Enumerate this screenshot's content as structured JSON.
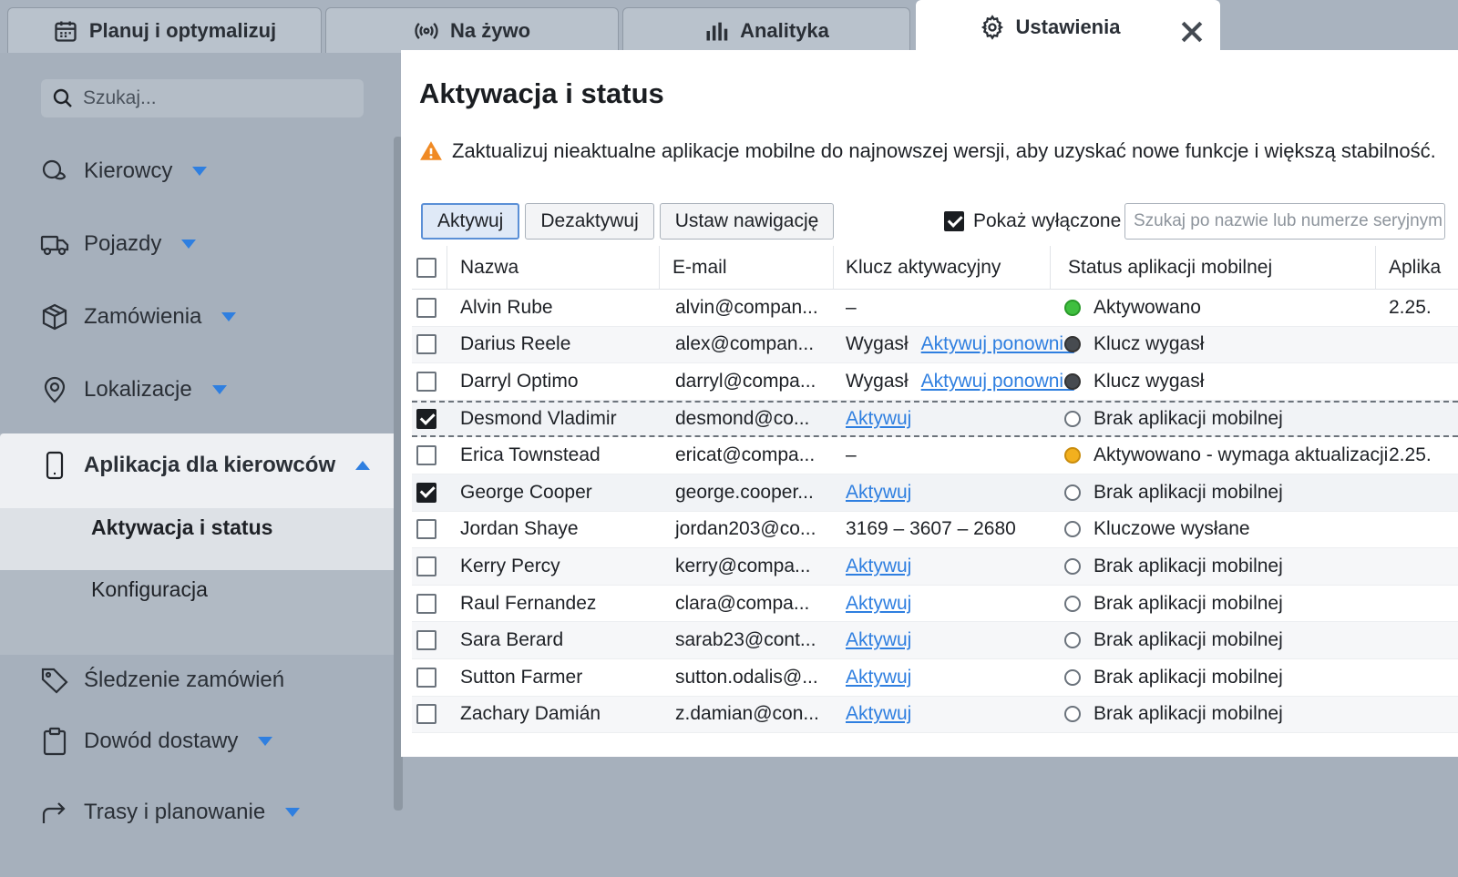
{
  "tabs": [
    {
      "label": "Planuj i optymalizuj",
      "icon": "calendar-icon"
    },
    {
      "label": "Na żywo",
      "icon": "broadcast-icon"
    },
    {
      "label": "Analityka",
      "icon": "bar-chart-icon"
    },
    {
      "label": "Ustawienia",
      "icon": "gear-icon",
      "active": true
    }
  ],
  "sidebar": {
    "search_placeholder": "Szukaj...",
    "items": [
      {
        "label": "Kierowcy",
        "icon": "drivers-icon"
      },
      {
        "label": "Pojazdy",
        "icon": "truck-icon"
      },
      {
        "label": "Zamówienia",
        "icon": "package-icon"
      },
      {
        "label": "Lokalizacje",
        "icon": "location-pin-icon"
      },
      {
        "label": "Aplikacja dla kierowców",
        "icon": "phone-icon"
      },
      {
        "label": "Śledzenie zamówień",
        "icon": "tag-icon"
      },
      {
        "label": "Dowód dostawy",
        "icon": "clipboard-icon"
      },
      {
        "label": "Trasy i planowanie",
        "icon": "route-arrow-icon"
      }
    ],
    "sub_items": [
      "Aktywacja i status",
      "Konfiguracja"
    ]
  },
  "main": {
    "title": "Aktywacja i status",
    "warning": "Zaktualizuj nieaktualne aplikacje mobilne do najnowszej wersji, aby uzyskać nowe funkcje i większą stabilność.",
    "buttons": {
      "activate": "Aktywuj",
      "deactivate": "Dezaktywuj",
      "set_nav": "Ustaw nawigację"
    },
    "show_disabled_label": "Pokaż wyłączone",
    "filter_placeholder": "Szukaj po nazwie lub numerze seryjnym"
  },
  "table": {
    "headers": [
      "Nazwa",
      "E-mail",
      "Klucz aktywacyjny",
      "Status aplikacji mobilnej",
      "Aplika"
    ],
    "rows": [
      {
        "name": "Alvin Rube",
        "email": "alvin@compan...",
        "key": "–",
        "key_link": "",
        "status": "Aktywowano",
        "dot": "green",
        "app": "2.25.",
        "checked": false
      },
      {
        "name": "Darius Reele",
        "email": "alex@compan...",
        "key": "Wygasł",
        "key_link": "Aktywuj ponownie",
        "status": "Klucz wygasł",
        "dot": "dark",
        "app": "",
        "checked": false
      },
      {
        "name": "Darryl Optimo",
        "email": "darryl@compa...",
        "key": "Wygasł",
        "key_link": "Aktywuj ponownie",
        "status": "Klucz wygasł",
        "dot": "dark",
        "app": "",
        "checked": false
      },
      {
        "name": "Desmond Vladimir",
        "email": "desmond@co...",
        "key": "",
        "key_link": "Aktywuj",
        "status": "Brak aplikacji mobilnej",
        "dot": "empty",
        "app": "",
        "checked": true
      },
      {
        "name": "Erica Townstead",
        "email": "ericat@compa...",
        "key": "–",
        "key_link": "",
        "status": "Aktywowano - wymaga aktualizacji",
        "dot": "orange",
        "app": "2.25.",
        "checked": false
      },
      {
        "name": "George Cooper",
        "email": "george.cooper...",
        "key": "",
        "key_link": "Aktywuj",
        "status": "Brak aplikacji mobilnej",
        "dot": "empty",
        "app": "",
        "checked": true
      },
      {
        "name": "Jordan Shaye",
        "email": "jordan203@co...",
        "key": "3169 – 3607 – 2680",
        "key_link": "",
        "status": "Kluczowe wysłane",
        "dot": "empty",
        "app": "",
        "checked": false
      },
      {
        "name": "Kerry Percy",
        "email": "kerry@compa...",
        "key": "",
        "key_link": "Aktywuj",
        "status": "Brak aplikacji mobilnej",
        "dot": "empty",
        "app": "",
        "checked": false
      },
      {
        "name": "Raul Fernandez",
        "email": "clara@compa...",
        "key": "",
        "key_link": "Aktywuj",
        "status": "Brak aplikacji mobilnej",
        "dot": "empty",
        "app": "",
        "checked": false
      },
      {
        "name": "Sara Berard",
        "email": "sarab23@cont...",
        "key": "",
        "key_link": "Aktywuj",
        "status": "Brak aplikacji mobilnej",
        "dot": "empty",
        "app": "",
        "checked": false
      },
      {
        "name": "Sutton Farmer",
        "email": "sutton.odalis@...",
        "key": "",
        "key_link": "Aktywuj",
        "status": "Brak aplikacji mobilnej",
        "dot": "empty",
        "app": "",
        "checked": false
      },
      {
        "name": "Zachary Damián",
        "email": "z.damian@con...",
        "key": "",
        "key_link": "Aktywuj",
        "status": "Brak aplikacji mobilnej",
        "dot": "empty",
        "app": "",
        "checked": false
      }
    ]
  }
}
